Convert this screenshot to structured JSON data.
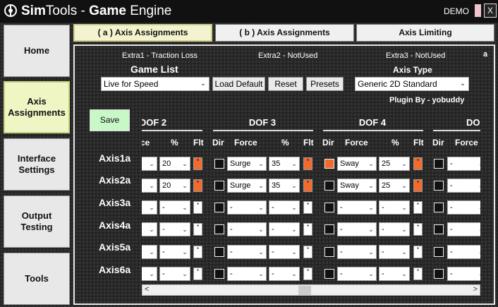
{
  "titlebar": {
    "brand_light": "Sim",
    "brand_tools": "Tools",
    "separator": " - ",
    "game_bold": "Game",
    "engine": " Engine",
    "demo": "DEMO",
    "close": "X"
  },
  "sidebar": {
    "home": "Home",
    "axis1": "Axis",
    "axis2": "Assignments",
    "iface1": "Interface",
    "iface2": "Settings",
    "out1": "Output",
    "out2": "Testing",
    "tools": "Tools"
  },
  "tabs": {
    "a": "( a ) Axis Assignments",
    "b": "( b ) Axis Assignments",
    "limit": "Axis Limiting"
  },
  "extras": {
    "e1": "Extra1 - Traction Loss",
    "e2": "Extra2 - NotUsed",
    "e3": "Extra3 - NotUsed",
    "corner": "a"
  },
  "game": {
    "label": "Game List",
    "value": "Live for Speed",
    "load_default": "Load Default",
    "reset": "Reset",
    "presets": "Presets"
  },
  "axis_type": {
    "label": "Axis Type",
    "value": "Generic 2D Standard"
  },
  "plugin": "Plugin By - yobuddy",
  "save": "Save",
  "headers": {
    "dof2": "DOF 2",
    "dof3": "DOF 3",
    "dof4": "DOF 4",
    "dof5": "DOF",
    "ce": "ce",
    "pct": "%",
    "flt": "Flt",
    "dir": "Dir",
    "force": "Force",
    "force_cut": "Force"
  },
  "flt_mark": "*",
  "rows": [
    {
      "label": "Axis1a",
      "d2pct": "20",
      "d2flt": true,
      "d3dir": false,
      "d3force": "Surge",
      "d3pct": "35",
      "d3flt": true,
      "d4dir": true,
      "d4force": "Sway",
      "d4pct": "25",
      "d4flt": true,
      "d5force": "-"
    },
    {
      "label": "Axis2a",
      "d2pct": "20",
      "d2flt": true,
      "d3dir": false,
      "d3force": "Surge",
      "d3pct": "35",
      "d3flt": true,
      "d4dir": false,
      "d4force": "Sway",
      "d4pct": "25",
      "d4flt": true,
      "d5force": "-"
    },
    {
      "label": "Axis3a",
      "d2pct": "-",
      "d2flt": false,
      "d3dir": false,
      "d3force": "-",
      "d3pct": "-",
      "d3flt": false,
      "d4dir": false,
      "d4force": "-",
      "d4pct": "-",
      "d4flt": false,
      "d5force": "-"
    },
    {
      "label": "Axis4a",
      "d2pct": "-",
      "d2flt": false,
      "d3dir": false,
      "d3force": "-",
      "d3pct": "-",
      "d3flt": false,
      "d4dir": false,
      "d4force": "-",
      "d4pct": "-",
      "d4flt": false,
      "d5force": "-"
    },
    {
      "label": "Axis5a",
      "d2pct": "-",
      "d2flt": false,
      "d3dir": false,
      "d3force": "-",
      "d3pct": "-",
      "d3flt": false,
      "d4dir": false,
      "d4force": "-",
      "d4pct": "-",
      "d4flt": false,
      "d5force": "-"
    },
    {
      "label": "Axis6a",
      "d2pct": "-",
      "d2flt": false,
      "d3dir": false,
      "d3force": "-",
      "d3pct": "-",
      "d3flt": false,
      "d4dir": false,
      "d4force": "-",
      "d4pct": "-",
      "d4flt": false,
      "d5force": "-"
    }
  ],
  "scroll": {
    "left": "<",
    "right": ">"
  },
  "colors": {
    "accent_orange": "#f26b2e",
    "active_tab": "#f3f3cf",
    "save_green": "#c8f7c8"
  }
}
